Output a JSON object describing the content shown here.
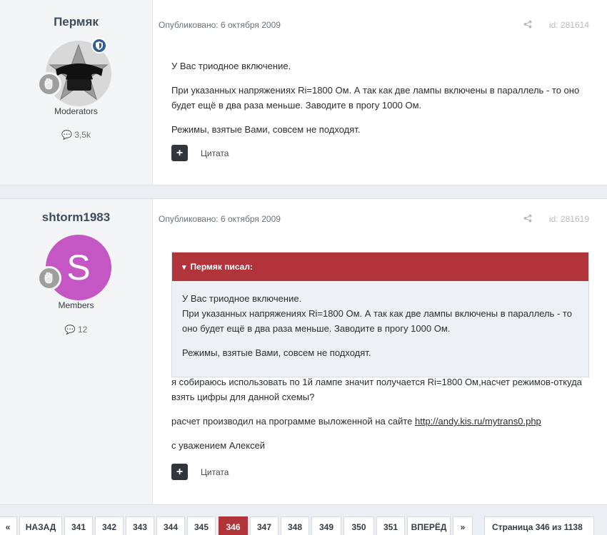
{
  "posts": [
    {
      "author": "Пермяк",
      "group": "Moderators",
      "post_count": "3,5k",
      "meta": "Опубликовано: 6 октября 2009",
      "post_id": "id: 281614",
      "paragraphs": [
        "У Вас триодное включение.",
        "При указанных напряжениях Ri=1800 Ом. А так как две лампы включены в параллель - то оно будет ещё в два раза меньше. Заводите в прогу 1000 Ом.",
        "Режимы, взятые Вами, совсем не подходят."
      ],
      "quote_label": "Цитата"
    },
    {
      "author": "shtorm1983",
      "avatar_letter": "S",
      "group": "Members",
      "post_count": "12",
      "meta": "Опубликовано: 6 октября 2009",
      "post_id": "id: 281619",
      "quote": {
        "header": "Пермяк писал:",
        "line1": "У Вас триодное включение.",
        "line2": "При указанных напряжениях Ri=1800 Ом. А так как две лампы включены в параллель - то оно будет ещё в два раза меньше. Заводите в прогу 1000 Ом.",
        "line3": "Режимы, взятые Вами, совсем не подходят."
      },
      "paragraph1": "я собираюсь использовать по 1й лампе значит получается Ri=1800 Ом,насчет режимов-откуда взять цифры для данной схемы?",
      "paragraph2_prefix": "расчет производил на программе выложенной на сайте ",
      "link": "http://andy.kis.ru/mytrans0.php",
      "paragraph3": "с уважением Алексей",
      "quote_label": "Цитата"
    }
  ],
  "pagination": {
    "first": "«",
    "prev": "НАЗАД",
    "pages": [
      "341",
      "342",
      "343",
      "344",
      "345",
      "346",
      "347",
      "348",
      "349",
      "350",
      "351"
    ],
    "current": "346",
    "next": "ВПЕРЁД",
    "last": "»",
    "jump": "Страница 346 из 1138"
  }
}
